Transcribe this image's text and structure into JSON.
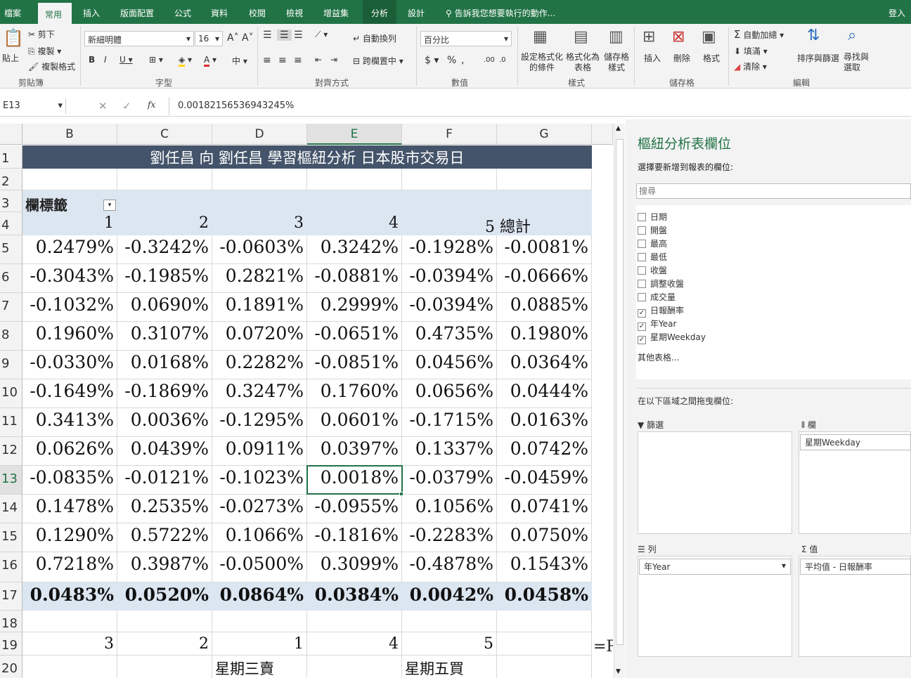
{
  "tabs": [
    "檔案",
    "常用",
    "插入",
    "版面配置",
    "公式",
    "資料",
    "校閱",
    "檢視",
    "增益集",
    "分析",
    "設計"
  ],
  "tell_me": "告訴我您想要執行的動作...",
  "sign_in": "登入",
  "ribbon": {
    "paste": "貼上",
    "cut": "剪下",
    "copy": "複製",
    "format_painter": "複製格式",
    "clipboard_group": "剪貼簿",
    "font_name": "新細明體",
    "font_size": "16",
    "font_group": "字型",
    "wrap_text": "自動換列",
    "merge_center": "跨欄置中",
    "align_group": "對齊方式",
    "number_format": "百分比",
    "number_group": "數值",
    "cond_format": "設定格式化的條件",
    "format_table": "格式化為表格",
    "cell_styles": "儲存格樣式",
    "styles_group": "樣式",
    "insert": "插入",
    "delete": "刪除",
    "format": "格式",
    "cells_group": "儲存格",
    "autosum": "自動加總",
    "fill": "填滿",
    "clear": "清除",
    "sort_filter": "排序與篩選",
    "find_select": "尋找與選取",
    "editing_group": "編輯"
  },
  "formula_bar": {
    "name_box": "E13",
    "fx": "fx",
    "value": "0.00182156536943245%"
  },
  "columns": [
    "B",
    "C",
    "D",
    "E",
    "F",
    "G"
  ],
  "rows": [
    "1",
    "2",
    "3",
    "4",
    "5",
    "6",
    "7",
    "8",
    "9",
    "10",
    "11",
    "12",
    "13",
    "14",
    "15",
    "16",
    "17",
    "18",
    "19",
    "20"
  ],
  "sheet": {
    "title": "劉任昌 向 劉任昌 學習樞紐分析 日本股市交易日",
    "col_labels": "欄標籤",
    "col_headers": [
      "1",
      "2",
      "3",
      "4",
      "5 總計"
    ],
    "data": [
      [
        "0.2479%",
        "-0.3242%",
        "-0.0603%",
        "0.3242%",
        "-0.1928%",
        "-0.0081%"
      ],
      [
        "-0.3043%",
        "-0.1985%",
        "0.2821%",
        "-0.0881%",
        "-0.0394%",
        "-0.0666%"
      ],
      [
        "-0.1032%",
        "0.0690%",
        "0.1891%",
        "0.2999%",
        "-0.0394%",
        "0.0885%"
      ],
      [
        "0.1960%",
        "0.3107%",
        "0.0720%",
        "-0.0651%",
        "0.4735%",
        "0.1980%"
      ],
      [
        "-0.0330%",
        "0.0168%",
        "0.2282%",
        "-0.0851%",
        "0.0456%",
        "0.0364%"
      ],
      [
        "-0.1649%",
        "-0.1869%",
        "0.3247%",
        "0.1760%",
        "0.0656%",
        "0.0444%"
      ],
      [
        "0.3413%",
        "0.0036%",
        "-0.1295%",
        "0.0601%",
        "-0.1715%",
        "0.0163%"
      ],
      [
        "0.0626%",
        "0.0439%",
        "0.0911%",
        "0.0397%",
        "0.1337%",
        "0.0742%"
      ],
      [
        "-0.0835%",
        "-0.0121%",
        "-0.1023%",
        "0.0018%",
        "-0.0379%",
        "-0.0459%"
      ],
      [
        "0.1478%",
        "0.2535%",
        "-0.0273%",
        "-0.0955%",
        "0.1056%",
        "0.0741%"
      ],
      [
        "0.1290%",
        "0.5722%",
        "0.1066%",
        "-0.1816%",
        "-0.2283%",
        "0.0750%"
      ],
      [
        "0.7218%",
        "0.3987%",
        "-0.0500%",
        "0.3099%",
        "-0.4878%",
        "0.1543%"
      ]
    ],
    "totals": [
      "0.0483%",
      "0.0520%",
      "0.0864%",
      "0.0384%",
      "0.0042%",
      "0.0458%"
    ],
    "row19": [
      "3",
      "2",
      "1",
      "4",
      "5"
    ],
    "row19_h": "=R",
    "row20": [
      "星期三賣",
      "星期五買"
    ]
  },
  "pivot_pane": {
    "title": "樞紐分析表欄位",
    "subtitle": "選擇要新增到報表的欄位:",
    "search_placeholder": "搜尋",
    "fields": [
      {
        "label": "日期",
        "checked": false
      },
      {
        "label": "開盤",
        "checked": false
      },
      {
        "label": "最高",
        "checked": false
      },
      {
        "label": "最低",
        "checked": false
      },
      {
        "label": "收盤",
        "checked": false
      },
      {
        "label": "調整收盤",
        "checked": false
      },
      {
        "label": "成交量",
        "checked": false
      },
      {
        "label": "日報酬率",
        "checked": true
      },
      {
        "label": "年Year",
        "checked": true
      },
      {
        "label": "星期Weekday",
        "checked": true
      }
    ],
    "more_tables": "其他表格...",
    "drag_label": "在以下區域之間拖曳欄位:",
    "filter_label": "篩選",
    "columns_label": "欄",
    "columns_item": "星期Weekday",
    "rows_label": "列",
    "rows_item": "年Year",
    "values_label": "值",
    "values_item": "平均值 - 日報酬率"
  }
}
